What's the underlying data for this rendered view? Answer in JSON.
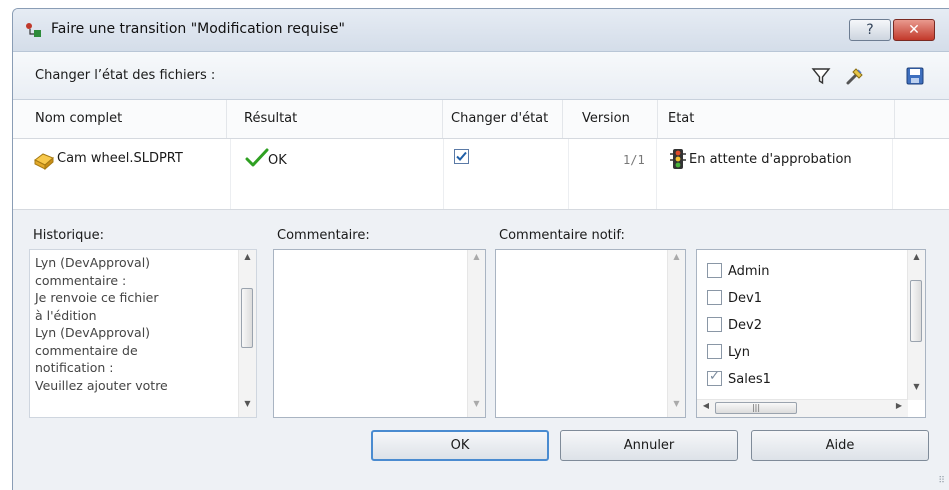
{
  "window": {
    "title": "Faire une transition \"Modification requise\""
  },
  "titlebar": {
    "help_label": "?",
    "close_label": "✕"
  },
  "subhead": {
    "label": "Changer l’état des fichiers :"
  },
  "icons": {
    "title": "transition-icon",
    "filter": "filter-icon",
    "tools": "wrench-icon",
    "save": "save-icon"
  },
  "grid": {
    "headers": [
      "Nom complet",
      "Résultat",
      "Changer d'état",
      "Version",
      "Etat"
    ],
    "rows": [
      {
        "name": "Cam wheel.SLDPRT",
        "result": "OK",
        "change_state": true,
        "version": "1/1",
        "state": "En attente d'approbation"
      }
    ]
  },
  "history": {
    "label": "Historique:",
    "lines": [
      "Lyn (DevApproval)",
      "commentaire :",
      "Je renvoie ce fichier",
      "à l'édition",
      "Lyn (DevApproval)",
      "commentaire de",
      "notification :",
      "Veuillez ajouter votre"
    ]
  },
  "comment": {
    "label": "Commentaire:",
    "value": ""
  },
  "notif_comment": {
    "label": "Commentaire notif:",
    "value": ""
  },
  "users": [
    {
      "name": "Admin",
      "checked": false
    },
    {
      "name": "Dev1",
      "checked": false
    },
    {
      "name": "Dev2",
      "checked": false
    },
    {
      "name": "Lyn",
      "checked": false
    },
    {
      "name": "Sales1",
      "checked": true
    }
  ],
  "buttons": {
    "ok": "OK",
    "cancel": "Annuler",
    "help": "Aide"
  },
  "colors": {
    "accent": "#4a8bd0",
    "close": "#c2392b",
    "check": "#2fa022"
  }
}
